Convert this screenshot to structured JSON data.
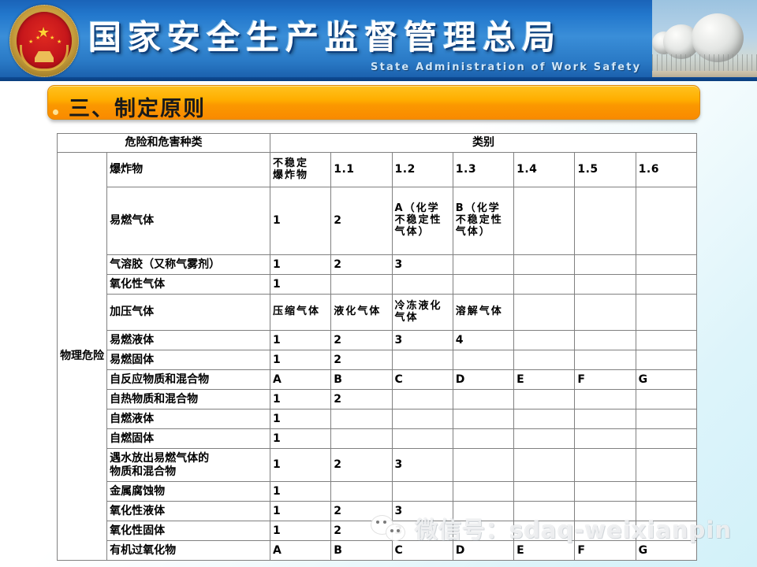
{
  "banner": {
    "emblem_name": "china-national-emblem",
    "title": "国家安全生产监督管理总局",
    "subtitle": "State  Administration  of  Work  Safety",
    "photo_name": "spherical-storage-tanks-photo",
    "background_color": "#2a7ac6"
  },
  "slide": {
    "title": "三、制定原则",
    "title_bar_color": "#fba800"
  },
  "watermark": {
    "text": "微信号：sdaq-weixianpin",
    "logo_name": "wechat-logo"
  },
  "table": {
    "header": {
      "left": "危险和危害种类",
      "right": "类别"
    },
    "group_label": "物理危险",
    "colors": {
      "orange": "#fcb514",
      "green": "#d5f5d0",
      "white": "#ffffff"
    },
    "rows": [
      {
        "name": "爆炸物",
        "height": "r-tall",
        "cells": [
          {
            "text": "不稳定\n爆炸物",
            "color": "orange",
            "multiline": true
          },
          {
            "text": "1.1",
            "color": "orange"
          },
          {
            "text": "1.2",
            "color": "orange"
          },
          {
            "text": "1.3",
            "color": "orange"
          },
          {
            "text": "1.4",
            "color": "orange"
          },
          {
            "text": "1.5",
            "color": "green"
          },
          {
            "text": "1.6",
            "color": "green"
          }
        ]
      },
      {
        "name": "易燃气体",
        "height": "r-xtall",
        "cells": [
          {
            "text": "1",
            "color": "orange"
          },
          {
            "text": "2",
            "color": "orange"
          },
          {
            "text": "A（化学不稳定性气体）",
            "color": "orange",
            "multiline": true
          },
          {
            "text": "B（化学不稳定性气体）",
            "color": "orange",
            "multiline": true
          },
          {
            "text": "",
            "color": "white"
          },
          {
            "text": "",
            "color": "white"
          },
          {
            "text": "",
            "color": "white"
          }
        ]
      },
      {
        "name": "气溶胶（又称气雾剂）",
        "height": "r-norm",
        "cells": [
          {
            "text": "1",
            "color": "orange"
          },
          {
            "text": "2",
            "color": "green"
          },
          {
            "text": "3",
            "color": "green"
          },
          {
            "text": "",
            "color": "white"
          },
          {
            "text": "",
            "color": "white"
          },
          {
            "text": "",
            "color": "white"
          },
          {
            "text": "",
            "color": "white"
          }
        ]
      },
      {
        "name": "氧化性气体",
        "height": "r-norm",
        "cells": [
          {
            "text": "1",
            "color": "orange"
          },
          {
            "text": "",
            "color": "white"
          },
          {
            "text": "",
            "color": "white"
          },
          {
            "text": "",
            "color": "white"
          },
          {
            "text": "",
            "color": "white"
          },
          {
            "text": "",
            "color": "white"
          },
          {
            "text": "",
            "color": "white"
          }
        ]
      },
      {
        "name": "加压气体",
        "height": "r-mid",
        "cells": [
          {
            "text": "压缩气体",
            "color": "orange",
            "multiline": true
          },
          {
            "text": "液化气体",
            "color": "orange",
            "multiline": true
          },
          {
            "text": "冷冻液化气体",
            "color": "orange",
            "multiline": true
          },
          {
            "text": "溶解气体",
            "color": "orange",
            "multiline": true
          },
          {
            "text": "",
            "color": "white"
          },
          {
            "text": "",
            "color": "white"
          },
          {
            "text": "",
            "color": "white"
          }
        ]
      },
      {
        "name": "易燃液体",
        "height": "r-norm",
        "cells": [
          {
            "text": "1",
            "color": "orange"
          },
          {
            "text": "2",
            "color": "orange"
          },
          {
            "text": "3",
            "color": "orange"
          },
          {
            "text": "4",
            "color": "green"
          },
          {
            "text": "",
            "color": "white"
          },
          {
            "text": "",
            "color": "white"
          },
          {
            "text": "",
            "color": "white"
          }
        ]
      },
      {
        "name": "易燃固体",
        "height": "r-norm",
        "cells": [
          {
            "text": "1",
            "color": "orange"
          },
          {
            "text": "2",
            "color": "orange"
          },
          {
            "text": "",
            "color": "white"
          },
          {
            "text": "",
            "color": "white"
          },
          {
            "text": "",
            "color": "white"
          },
          {
            "text": "",
            "color": "white"
          },
          {
            "text": "",
            "color": "white"
          }
        ]
      },
      {
        "name": "自反应物质和混合物",
        "height": "r-norm",
        "cells": [
          {
            "text": "A",
            "color": "orange"
          },
          {
            "text": "B",
            "color": "orange"
          },
          {
            "text": "C",
            "color": "orange"
          },
          {
            "text": "D",
            "color": "orange"
          },
          {
            "text": "E",
            "color": "orange"
          },
          {
            "text": "F",
            "color": "green"
          },
          {
            "text": "G",
            "color": "green"
          }
        ]
      },
      {
        "name": "自热物质和混合物",
        "height": "r-norm",
        "cells": [
          {
            "text": "1",
            "color": "orange"
          },
          {
            "text": "2",
            "color": "orange"
          },
          {
            "text": "",
            "color": "white"
          },
          {
            "text": "",
            "color": "white"
          },
          {
            "text": "",
            "color": "white"
          },
          {
            "text": "",
            "color": "white"
          },
          {
            "text": "",
            "color": "white"
          }
        ]
      },
      {
        "name": "自燃液体",
        "height": "r-norm",
        "cells": [
          {
            "text": "1",
            "color": "orange"
          },
          {
            "text": "",
            "color": "white"
          },
          {
            "text": "",
            "color": "white"
          },
          {
            "text": "",
            "color": "white"
          },
          {
            "text": "",
            "color": "white"
          },
          {
            "text": "",
            "color": "white"
          },
          {
            "text": "",
            "color": "white"
          }
        ]
      },
      {
        "name": "自燃固体",
        "height": "r-norm",
        "cells": [
          {
            "text": "1",
            "color": "orange"
          },
          {
            "text": "",
            "color": "white"
          },
          {
            "text": "",
            "color": "white"
          },
          {
            "text": "",
            "color": "white"
          },
          {
            "text": "",
            "color": "white"
          },
          {
            "text": "",
            "color": "white"
          },
          {
            "text": "",
            "color": "white"
          }
        ]
      },
      {
        "name": "遇水放出易燃气体的\n物质和混合物",
        "height": "r-two",
        "multiline_name": true,
        "cells": [
          {
            "text": "1",
            "color": "orange"
          },
          {
            "text": "2",
            "color": "orange"
          },
          {
            "text": "3",
            "color": "orange"
          },
          {
            "text": "",
            "color": "white"
          },
          {
            "text": "",
            "color": "white"
          },
          {
            "text": "",
            "color": "white"
          },
          {
            "text": "",
            "color": "white"
          }
        ]
      },
      {
        "name": "金属腐蚀物",
        "height": "r-norm",
        "cells": [
          {
            "text": "1",
            "color": "orange"
          },
          {
            "text": "",
            "color": "white"
          },
          {
            "text": "",
            "color": "white"
          },
          {
            "text": "",
            "color": "white"
          },
          {
            "text": "",
            "color": "white"
          },
          {
            "text": "",
            "color": "white"
          },
          {
            "text": "",
            "color": "white"
          }
        ]
      },
      {
        "name": "氧化性液体",
        "height": "r-norm",
        "cells": [
          {
            "text": "1",
            "color": "orange"
          },
          {
            "text": "2",
            "color": "orange"
          },
          {
            "text": "3",
            "color": "orange"
          },
          {
            "text": "",
            "color": "white"
          },
          {
            "text": "",
            "color": "white"
          },
          {
            "text": "",
            "color": "white"
          },
          {
            "text": "",
            "color": "white"
          }
        ]
      },
      {
        "name": "氧化性固体",
        "height": "r-norm",
        "cells": [
          {
            "text": "1",
            "color": "orange"
          },
          {
            "text": "2",
            "color": "orange"
          },
          {
            "text": "3",
            "color": "orange"
          },
          {
            "text": "",
            "color": "white"
          },
          {
            "text": "",
            "color": "white"
          },
          {
            "text": "",
            "color": "white"
          },
          {
            "text": "",
            "color": "white"
          }
        ]
      },
      {
        "name": "有机过氧化物",
        "height": "r-norm",
        "cells": [
          {
            "text": "A",
            "color": "orange"
          },
          {
            "text": "B",
            "color": "orange"
          },
          {
            "text": "C",
            "color": "orange"
          },
          {
            "text": "D",
            "color": "orange"
          },
          {
            "text": "E",
            "color": "orange"
          },
          {
            "text": "F",
            "color": "orange"
          },
          {
            "text": "G",
            "color": "green"
          }
        ]
      }
    ]
  }
}
